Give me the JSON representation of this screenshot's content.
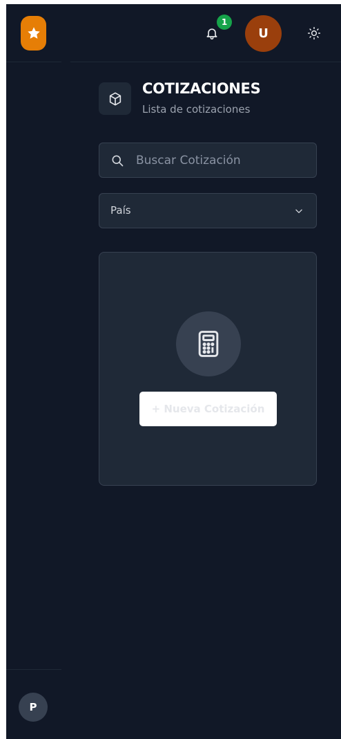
{
  "header": {
    "notification_count": "1",
    "user_initial": "U",
    "bell_icon": "bell-icon",
    "theme_icon": "sun-icon"
  },
  "sidebar": {
    "logo_icon": "star-icon",
    "user_initial": "P"
  },
  "page": {
    "icon": "cube-icon",
    "title": "COTIZACIONES",
    "subtitle": "Lista de cotizaciones"
  },
  "search": {
    "placeholder": "Buscar Cotización"
  },
  "country_select": {
    "label": "País"
  },
  "empty_state": {
    "icon": "calculator-icon",
    "button_label": "+ Nueva Cotización"
  },
  "colors": {
    "background": "#111827",
    "panel": "#1f2937",
    "accent_orange": "#e67e06",
    "avatar_brown": "#9a3f0c",
    "badge_green": "#16a34a"
  }
}
